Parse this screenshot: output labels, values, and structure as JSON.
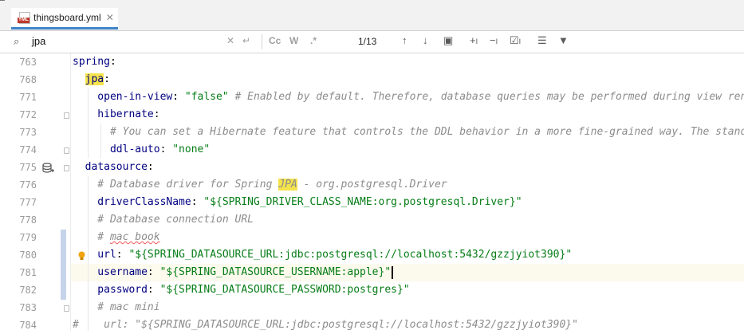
{
  "tab": {
    "filename": "thingsboard.yml",
    "icon": "yml-file-icon",
    "icon_label": "YML"
  },
  "search": {
    "query": "jpa",
    "match_count": "1/13",
    "case_toggle": "Cc",
    "word_toggle": "W",
    "regex_toggle": ".*"
  },
  "colors": {
    "key": "#000080",
    "string": "#067d17",
    "comment": "#8c8c8c",
    "match": "#f5e34d",
    "current_line": "#fcfaed"
  },
  "lines": [
    {
      "num": "763",
      "code": [
        {
          "t": "spring",
          "c": "key"
        },
        {
          "t": ":",
          "c": "plain"
        }
      ]
    },
    {
      "num": "768",
      "code": [
        {
          "t": "  ",
          "c": "plain"
        },
        {
          "t": "jpa",
          "c": "key",
          "m": true
        },
        {
          "t": ":",
          "c": "plain"
        }
      ]
    },
    {
      "num": "771",
      "code": [
        {
          "t": "    open-in-view",
          "c": "key"
        },
        {
          "t": ": ",
          "c": "plain"
        },
        {
          "t": "\"false\"",
          "c": "str"
        },
        {
          "t": " # Enabled by default. Therefore, database queries may be performed during view ren",
          "c": "cmt"
        }
      ]
    },
    {
      "num": "772",
      "code": [
        {
          "t": "    hibernate",
          "c": "key"
        },
        {
          "t": ":",
          "c": "plain"
        }
      ]
    },
    {
      "num": "773",
      "code": [
        {
          "t": "      # You can set a Hibernate feature that controls the DDL behavior in a more fine-grained way. The stand",
          "c": "cmt"
        }
      ]
    },
    {
      "num": "774",
      "code": [
        {
          "t": "      ddl-auto",
          "c": "key"
        },
        {
          "t": ": ",
          "c": "plain"
        },
        {
          "t": "\"none\"",
          "c": "str"
        }
      ]
    },
    {
      "num": "775",
      "code": [
        {
          "t": "  datasource",
          "c": "key"
        },
        {
          "t": ":",
          "c": "plain"
        }
      ]
    },
    {
      "num": "776",
      "code": [
        {
          "t": "    # Database driver for Spring ",
          "c": "cmt"
        },
        {
          "t": "JPA",
          "c": "cmt",
          "m": true
        },
        {
          "t": " - org.postgresql.Driver",
          "c": "cmt"
        }
      ]
    },
    {
      "num": "777",
      "code": [
        {
          "t": "    driverClassName",
          "c": "key"
        },
        {
          "t": ": ",
          "c": "plain"
        },
        {
          "t": "\"${SPRING_DRIVER_CLASS_NAME:org.postgresql.Driver}\"",
          "c": "str"
        }
      ]
    },
    {
      "num": "778",
      "code": [
        {
          "t": "    # Database connection URL",
          "c": "cmt"
        }
      ]
    },
    {
      "num": "779",
      "code": [
        {
          "t": "    # ",
          "c": "cmt"
        },
        {
          "t": "mac book",
          "c": "cmt",
          "sq": true
        }
      ]
    },
    {
      "num": "780",
      "code": [
        {
          "t": "    url",
          "c": "key"
        },
        {
          "t": ": ",
          "c": "plain"
        },
        {
          "t": "\"${SPRING_DATASOURCE_URL:jdbc:postgresql://localhost:5432/gzzjyiot390}\"",
          "c": "str"
        }
      ]
    },
    {
      "num": "781",
      "code": [
        {
          "t": "    username",
          "c": "key"
        },
        {
          "t": ": ",
          "c": "plain"
        },
        {
          "t": "\"${SPRING_DATASOURCE_USERNAME:apple}\"",
          "c": "str"
        }
      ],
      "caret": true
    },
    {
      "num": "782",
      "code": [
        {
          "t": "    password",
          "c": "key"
        },
        {
          "t": ": ",
          "c": "plain"
        },
        {
          "t": "\"${SPRING_DATASOURCE_PASSWORD:postgres}\"",
          "c": "str"
        }
      ]
    },
    {
      "num": "783",
      "code": [
        {
          "t": "    # mac mini",
          "c": "cmt"
        }
      ]
    },
    {
      "num": "784",
      "code": [
        {
          "t": "#    url: \"${SPRING_DATASOURCE_URL:jdbc:postgresql://localhost:5432/gzzjyiot390}\"",
          "c": "cmt"
        }
      ]
    }
  ]
}
